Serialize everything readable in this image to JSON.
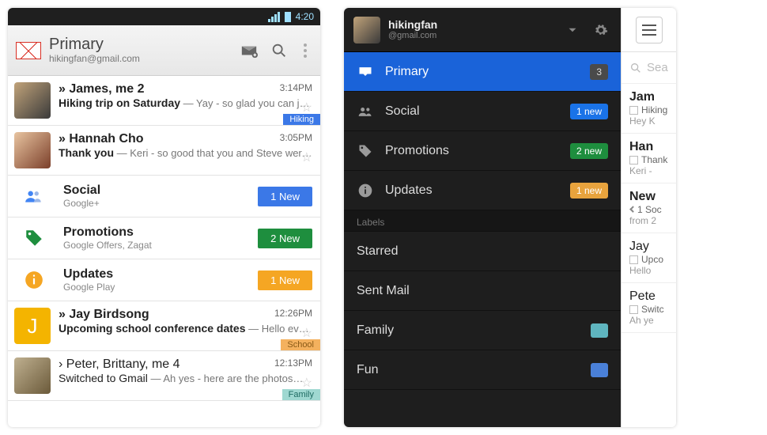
{
  "android": {
    "status_time": "4:20",
    "header": {
      "title": "Primary",
      "subtitle": "hikingfan@gmail.com"
    },
    "rows": [
      {
        "sender": "» James, me  2",
        "subject": "Hiking trip on Saturday",
        "sep": " — ",
        "snippet": "Yay - so glad you can join. We should leave from here around…",
        "time": "3:14PM",
        "chip": "Hiking"
      },
      {
        "sender": "» Hannah Cho",
        "subject": "Thank you",
        "sep": " — ",
        "snippet": "Keri - so good that you and Steve were able to come over. Thank you so…",
        "time": "3:05PM"
      }
    ],
    "cats": [
      {
        "name": "Social",
        "sub": "Google+",
        "badge": "1 New"
      },
      {
        "name": "Promotions",
        "sub": "Google Offers, Zagat",
        "badge": "2 New"
      },
      {
        "name": "Updates",
        "sub": "Google Play",
        "badge": "1 New"
      }
    ],
    "rows2": [
      {
        "sender": "» Jay Birdsong",
        "subject": "Upcoming school conference dates",
        "sep": " — ",
        "snippet": "Hello everyone, A few people have asked about thi…",
        "time": "12:26PM",
        "chip": "School"
      },
      {
        "sender": "› Peter, Brittany, me  4",
        "subject": "Switched to Gmail",
        "sep": " — ",
        "snippet": "Ah yes - here are the photos… there are loads but this will do for…",
        "time": "12:13PM",
        "chip": "Family"
      }
    ]
  },
  "ios": {
    "account": {
      "name": "hikingfan",
      "mail": "@gmail.com"
    },
    "items": [
      {
        "label": "Primary",
        "badge": "3"
      },
      {
        "label": "Social",
        "badge": "1 new"
      },
      {
        "label": "Promotions",
        "badge": "2 new"
      },
      {
        "label": "Updates",
        "badge": "1 new"
      }
    ],
    "labels_header": "Labels",
    "labels": [
      {
        "label": "Starred"
      },
      {
        "label": "Sent Mail"
      },
      {
        "label": "Family"
      },
      {
        "label": "Fun"
      }
    ],
    "peek": {
      "search": "Sea",
      "rows": [
        {
          "sender": "Jam",
          "line1": "Hiking",
          "line2": "Hey K"
        },
        {
          "sender": "Han",
          "line1": "Thank",
          "line2": "Keri -"
        },
        {
          "sender": "New",
          "line1": "1 Soc",
          "line2": "from 2"
        },
        {
          "sender": "Jay",
          "line1": "Upco",
          "line2": "Hello"
        },
        {
          "sender": "Pete",
          "line1": "Switc",
          "line2": "Ah ye"
        }
      ]
    }
  }
}
